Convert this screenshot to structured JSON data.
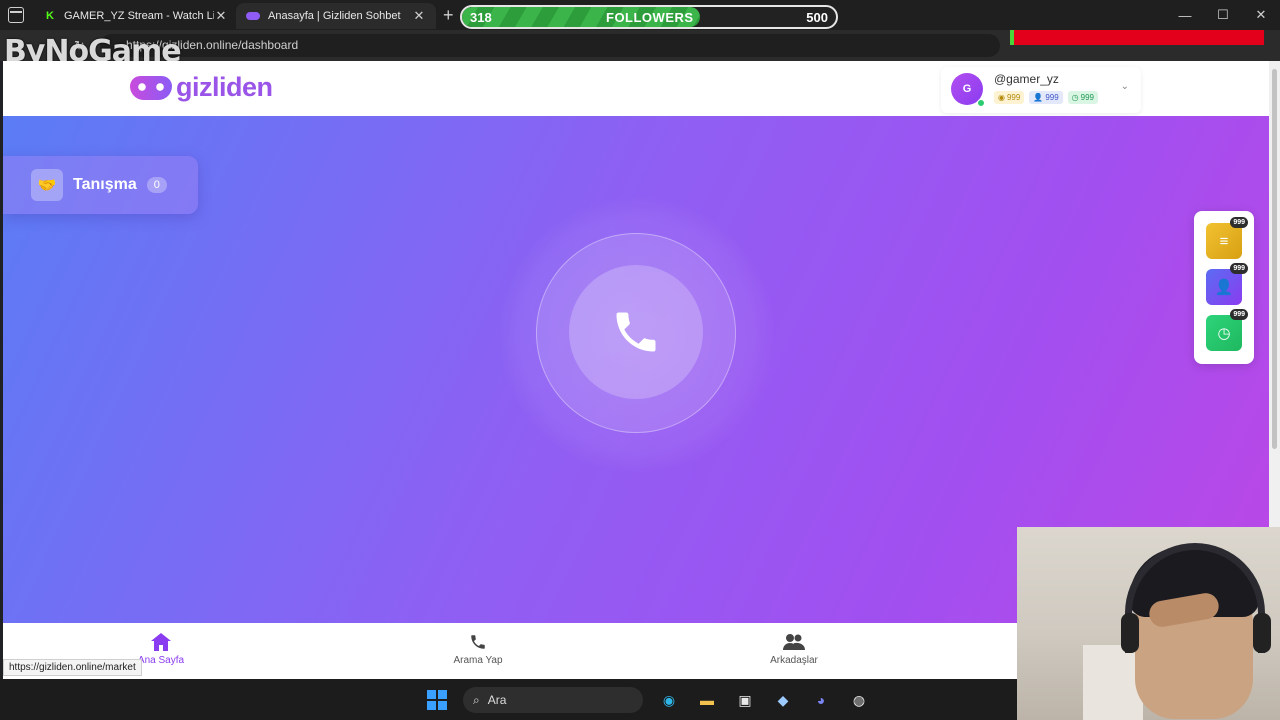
{
  "browser": {
    "tabs": [
      {
        "title": "GAMER_YZ Stream - Watch Live o",
        "favicon": "kick-icon"
      },
      {
        "title": "Anasayfa | Gizliden Sohbet",
        "favicon": "mask-icon"
      }
    ],
    "url": "https://gizliden.online/dashboard",
    "status_url": "https://gizliden.online/market",
    "watermark": "ByNoGame"
  },
  "followers_overlay": {
    "current": "318",
    "label": "FOLLOWERS",
    "goal": "500",
    "progress": 0.636
  },
  "header": {
    "logo_text": "gizliden",
    "user": {
      "avatar_letter": "G",
      "username": "@gamer_yz",
      "gold": "999",
      "friends": "999",
      "time": "999"
    }
  },
  "hero": {
    "tanisma": {
      "label": "Tanışma",
      "count": "0"
    },
    "side_panel": {
      "gold": "999",
      "friends": "999",
      "time": "999"
    }
  },
  "bottom_nav": [
    {
      "label": "Ana Sayfa",
      "icon": "home-icon",
      "active": true
    },
    {
      "label": "Arama Yap",
      "icon": "phone-icon",
      "active": false
    },
    {
      "label": "Arkadaşlar",
      "icon": "users-icon",
      "active": false
    }
  ],
  "taskbar": {
    "search_label": "Ara"
  },
  "colors": {
    "accent": "#8a3cf0",
    "hero_start": "#5b7cf5",
    "hero_end": "#bb47e6",
    "gold": "#f1c232",
    "green": "#2ed47a"
  }
}
